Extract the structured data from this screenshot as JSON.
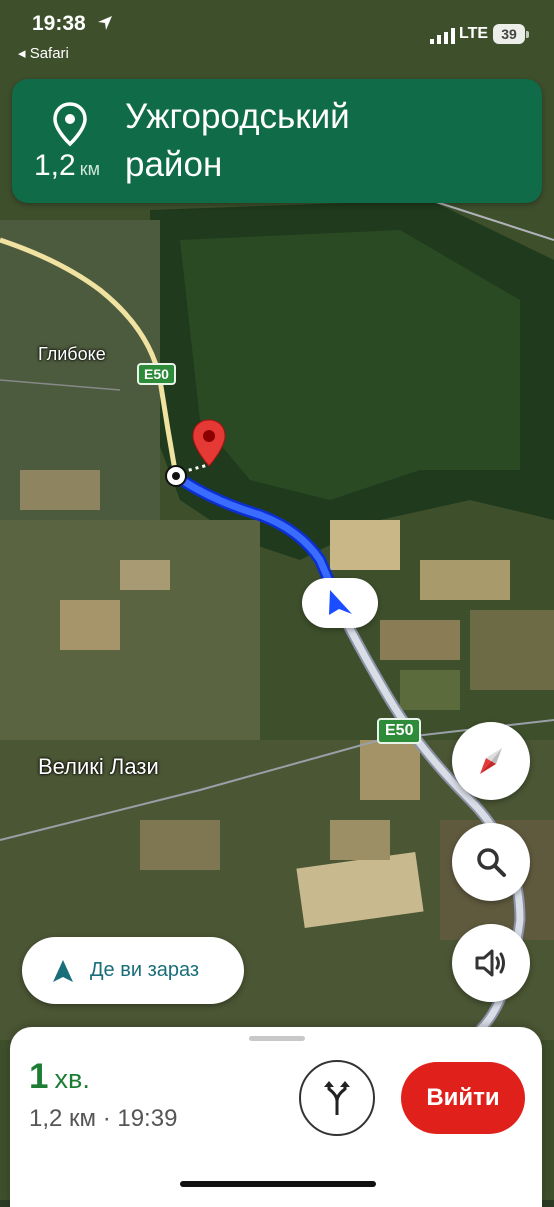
{
  "status_bar": {
    "time": "19:38",
    "back_app": "Safari",
    "network": "LTE",
    "battery": "39"
  },
  "banner": {
    "icon": "location-pin-icon",
    "title_line1": "Ужгородський",
    "title_line2": "район",
    "distance_value": "1,2",
    "distance_unit": "км"
  },
  "map": {
    "labels": {
      "village_north": "Глибоке",
      "village_south": "Великі Лази"
    },
    "road_shields": [
      "E50",
      "E50"
    ],
    "colors": {
      "route": "#1a4dff",
      "road": "#d9dde6",
      "destination_pin": "#e53935"
    }
  },
  "controls": {
    "compass_icon": "compass-icon",
    "search_icon": "search-icon",
    "sound_icon": "speaker-icon",
    "where_label": "Де ви зараз"
  },
  "trip": {
    "eta_value": "1",
    "eta_unit": "хв.",
    "details": "1,2 км · 19:39",
    "exit_label": "Вийти",
    "routes_icon": "alternate-routes-icon"
  },
  "colors": {
    "banner": "#0f6b48",
    "eta": "#1e7d34",
    "exit": "#e0211b"
  }
}
